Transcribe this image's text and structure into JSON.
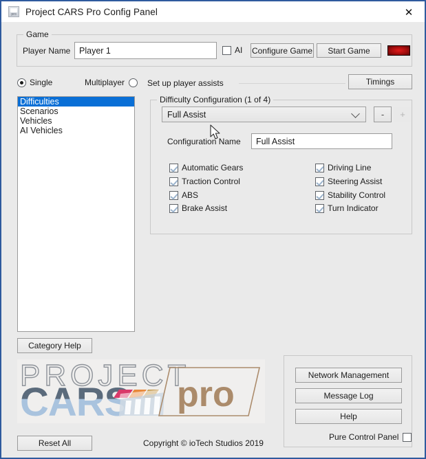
{
  "window": {
    "title": "Project CARS Pro Config Panel",
    "close_label": "✕",
    "icon_name": "app-pro-icon",
    "border_color": "#2f5a9e"
  },
  "game_group": {
    "title": "Game",
    "player_name_label": "Player Name",
    "player_name_value": "Player 1",
    "player_name_placeholder": "Player 1",
    "ai_label": "AI",
    "ai_checked": false,
    "configure_game_label": "Configure Game",
    "start_game_label": "Start Game",
    "status_indicator_name": "status-indicator-red",
    "status_indicator_color": "#a30d0d"
  },
  "mode": {
    "single_label": "Single",
    "single_selected": true,
    "multiplayer_label": "Multiplayer",
    "multiplayer_selected": false
  },
  "categories": {
    "items": [
      {
        "label": "Difficulties",
        "selected": true
      },
      {
        "label": "Scenarios",
        "selected": false
      },
      {
        "label": "Vehicles",
        "selected": false
      },
      {
        "label": "AI Vehicles",
        "selected": false
      }
    ],
    "help_button_label": "Category Help",
    "selection_color": "#0a6fd6"
  },
  "assists": {
    "hint": "Set up player assists",
    "timings_label": "Timings",
    "group_title": "Difficulty Configuration (1 of 4)",
    "preset_value": "Full Assist",
    "remove_label": "-",
    "add_label": "+",
    "remove_enabled": true,
    "add_enabled": false,
    "config_name_label": "Configuration Name",
    "config_name_value": "Full Assist",
    "config_name_placeholder": "Full Assist",
    "left_column": [
      {
        "label": "Automatic Gears",
        "checked": true
      },
      {
        "label": "Traction Control",
        "checked": true
      },
      {
        "label": "ABS",
        "checked": true
      },
      {
        "label": "Brake Assist",
        "checked": true
      }
    ],
    "right_column": [
      {
        "label": "Driving Line",
        "checked": true
      },
      {
        "label": "Steering Assist",
        "checked": true
      },
      {
        "label": "Stability Control",
        "checked": true
      },
      {
        "label": "Turn Indicator",
        "checked": true
      }
    ]
  },
  "logo": {
    "word_top": "PROJECT",
    "word_main": "CARS",
    "word_pro": "pro",
    "colors": {
      "project_gray": "#8d9299",
      "cars_dark": "#5b6b7c",
      "cars_light": "#a9c3de",
      "pro_tan": "#ab8b6b",
      "accent_pink": "#d9396a",
      "accent_orange": "#e8883a",
      "accent_gold": "#c59a4e"
    }
  },
  "tools": {
    "network_management_label": "Network Management",
    "message_log_label": "Message Log",
    "help_label": "Help",
    "pure_control_panel_label": "Pure Control Panel",
    "pure_control_panel_checked": false
  },
  "footer": {
    "reset_all_label": "Reset All",
    "copyright": "Copyright © ioTech Studios 2019"
  }
}
